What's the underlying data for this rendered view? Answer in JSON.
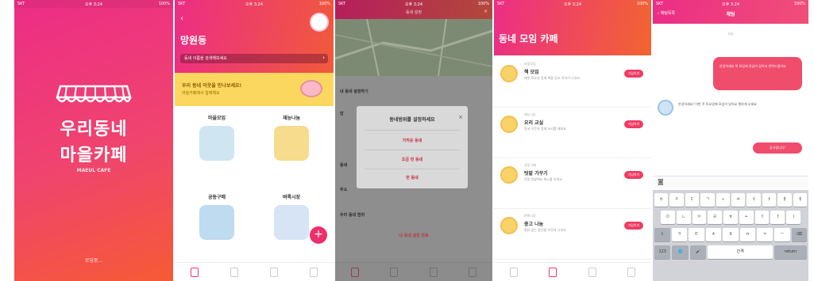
{
  "status_bar": {
    "carrier": "SKT",
    "time": "오후 3:24",
    "battery": "100%"
  },
  "splash": {
    "logo_line1": "우리동네",
    "logo_line2": "마을카페",
    "logo_sub": "MAEUL CAFE",
    "bottom_text": "로딩중..."
  },
  "home": {
    "back_label": "‹",
    "title": "망원동",
    "search_placeholder": "동네 이름을 검색해보세요",
    "search_icon": "chevron-right-icon",
    "banner_line1": "우리 동네 이웃을 만나보세요!",
    "banner_line2": "마을카페에서 함께해요",
    "categories": [
      {
        "label": "마을모임"
      },
      {
        "label": "재능나눔"
      },
      {
        "label": "공동구매"
      },
      {
        "label": "벼룩시장"
      }
    ],
    "fab_label": "+"
  },
  "map_modal": {
    "header_title": "동네 설정",
    "close_label": "×",
    "row1": "내 동네 설정하기",
    "row2": "망",
    "row3": "동네",
    "row4": "주소",
    "row5": "우리 동네 범위",
    "bottom_link": "내 동네 설정 완료",
    "modal_title": "동네범위를 설정하세요",
    "modal_close": "×",
    "options": [
      "가까운 동네",
      "조금 먼 동네",
      "먼 동네"
    ]
  },
  "list": {
    "title": "동네 모임 카페",
    "items": [
      {
        "category": "마을모임",
        "name": "책 모임",
        "desc": "매주 토요일 함께 책을 읽고 이야기 나눠요",
        "button": "가입하기"
      },
      {
        "category": "재능나눔",
        "name": "요리 교실",
        "desc": "동네 이웃과 함께 요리를 배워요",
        "button": "가입하기"
      },
      {
        "category": "공동구매",
        "name": "텃밭 가꾸기",
        "desc": "주말 텃밭에서 채소를 키워요",
        "button": "가입하기"
      },
      {
        "category": "벼룩시장",
        "name": "중고 나눔",
        "desc": "필요 없는 물건을 이웃과 나눠요",
        "button": "가입하기"
      }
    ]
  },
  "chat": {
    "back_label": "‹ 채팅목록",
    "title": "채팅",
    "date": "오늘",
    "msg_out1": "안녕하세요 책 모임에 관심이 있어서 연락드렸어요",
    "msg_in": "안녕하세요! 이번 주 토요일에 모임이 있어요 편하게 오세요",
    "msg_out2": "감사합니다!",
    "input_icon": "camera-icon",
    "keys_row1": [
      "ㅂ",
      "ㅈ",
      "ㄷ",
      "ㄱ",
      "ㅅ",
      "ㅛ",
      "ㅕ",
      "ㅑ",
      "ㅐ",
      "ㅔ"
    ],
    "keys_row2": [
      "ㅁ",
      "ㄴ",
      "ㅇ",
      "ㄹ",
      "ㅎ",
      "ㅗ",
      "ㅓ",
      "ㅏ",
      "ㅣ"
    ],
    "keys_row3": [
      "⇧",
      "ㅋ",
      "ㅌ",
      "ㅊ",
      "ㅍ",
      "ㅠ",
      "ㅜ",
      "ㅡ",
      "⌫"
    ],
    "keys_row4": [
      "123",
      "🌐",
      "🎤",
      "간격",
      "return"
    ]
  },
  "colors": {
    "brand_pink": "#ec2d86",
    "brand_orange": "#f65a34",
    "accent_red": "#ef3b63",
    "banner_yellow": "#fbd75f"
  }
}
